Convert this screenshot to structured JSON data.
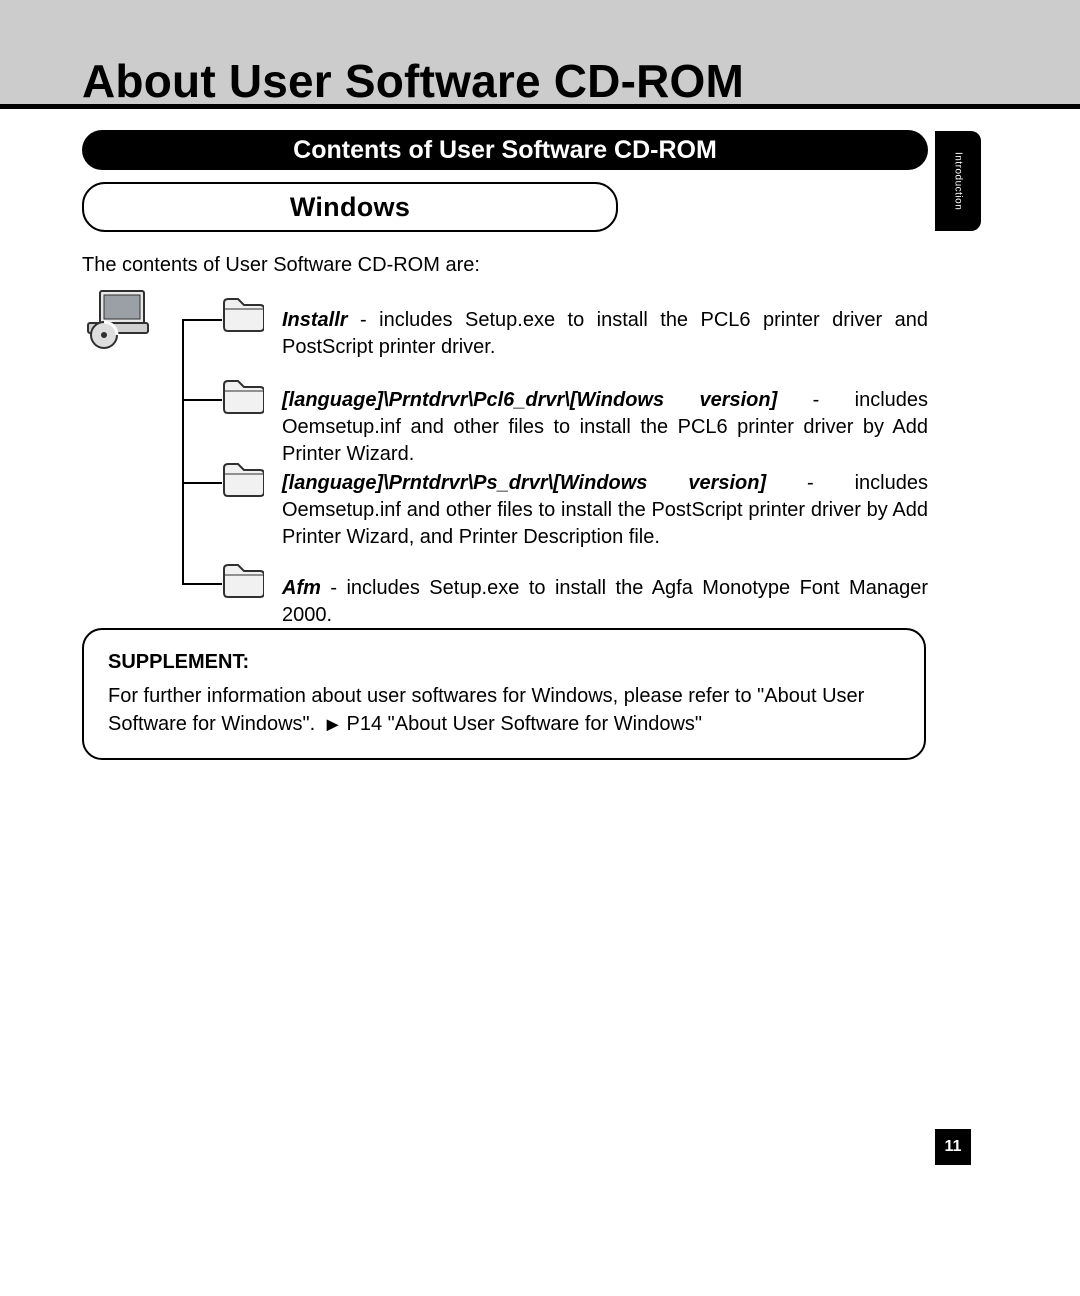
{
  "page": {
    "title": "About User Software CD-ROM",
    "side_tab": "Introduction",
    "page_number": "11"
  },
  "section": {
    "heading": "Contents of User Software CD-ROM",
    "subheading": "Windows",
    "intro": "The contents of User Software CD-ROM are:"
  },
  "tree": {
    "items": [
      {
        "title": "Installr",
        "rest": " - includes Setup.exe to install the PCL6 printer driver and PostScript printer driver."
      },
      {
        "title": "[language]\\Prntdrvr\\Pcl6_drvr\\[Windows version]",
        "rest": " - includes Oemsetup.inf and other files to install the PCL6 printer driver by Add Printer Wizard."
      },
      {
        "title": "[language]\\Prntdrvr\\Ps_drvr\\[Windows version]",
        "rest": " - includes Oemsetup.inf and other files to install the PostScript printer driver by Add Printer Wizard, and Printer Description file."
      },
      {
        "title": "Afm",
        "rest": " - includes Setup.exe to install the Agfa Monotype Font Manager 2000."
      }
    ]
  },
  "supplement": {
    "label": "SUPPLEMENT:",
    "before": "For further information about user softwares for Windows, please refer to \"About User Software for Windows\". ",
    "arrow": "►",
    "link": "P14 \"About User Software for Windows\""
  }
}
